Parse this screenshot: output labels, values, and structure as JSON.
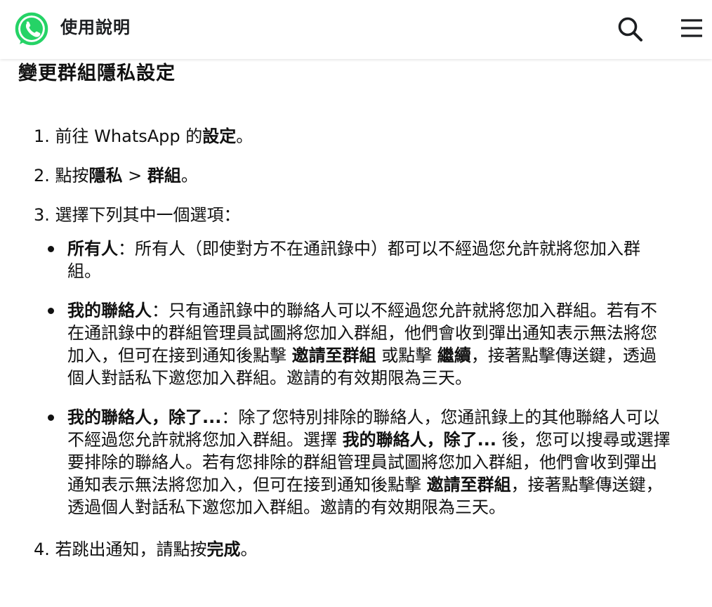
{
  "header": {
    "title": "使用說明",
    "logo_icon": "whatsapp-logo-icon",
    "search_icon": "search-icon",
    "menu_icon": "hamburger-menu-icon",
    "brand_color": "#25D366"
  },
  "article": {
    "title": "變更群組隱私設定",
    "steps": [
      {
        "num": "1.",
        "text_before": "前往 WhatsApp 的",
        "bold": "設定",
        "text_after": "。"
      },
      {
        "num": "2.",
        "text_before": "點按",
        "bold1": "隱私",
        "separator": " > ",
        "bold2": "群組",
        "text_after": "。"
      },
      {
        "num": "3.",
        "text": "選擇下列其中一個選項：",
        "options": [
          {
            "label": "所有人",
            "text": "：所有人（即使對方不在通訊錄中）都可以不經過您允許就將您加入群組。"
          },
          {
            "label": "我的聯絡人",
            "text_1": "：只有通訊錄中的聯絡人可以不經過您允許就將您加入群組。若有不在通訊錄中的群組管理員試圖將您加入群組，他們會收到彈出通知表示無法將您加入，但可在接到通知後點擊 ",
            "bold_1": "邀請至群組",
            "text_2": " 或點擊 ",
            "bold_2": "繼續",
            "text_3": "，接著點擊傳送鍵，透過個人對話私下邀您加入群組。邀請的有效期限為三天。"
          },
          {
            "label": "我的聯絡人，除了...",
            "text_1": "：除了您特別排除的聯絡人，您通訊錄上的其他聯絡人可以不經過您允許就將您加入群組。選擇 ",
            "bold_1": "我的聯絡人，除了...",
            "text_2": " 後，您可以搜尋或選擇要排除的聯絡人。若有您排除的群組管理員試圖將您加入群組，他們會收到彈出通知表示無法將您加入，但可在接到通知後點擊 ",
            "bold_2": "邀請至群組",
            "text_3": "，接著點擊傳送鍵，透過個人對話私下邀您加入群組。邀請的有效期限為三天。"
          }
        ]
      },
      {
        "num": "4.",
        "text_before": "若跳出通知，請點按",
        "bold": "完成",
        "text_after": "。"
      }
    ]
  }
}
